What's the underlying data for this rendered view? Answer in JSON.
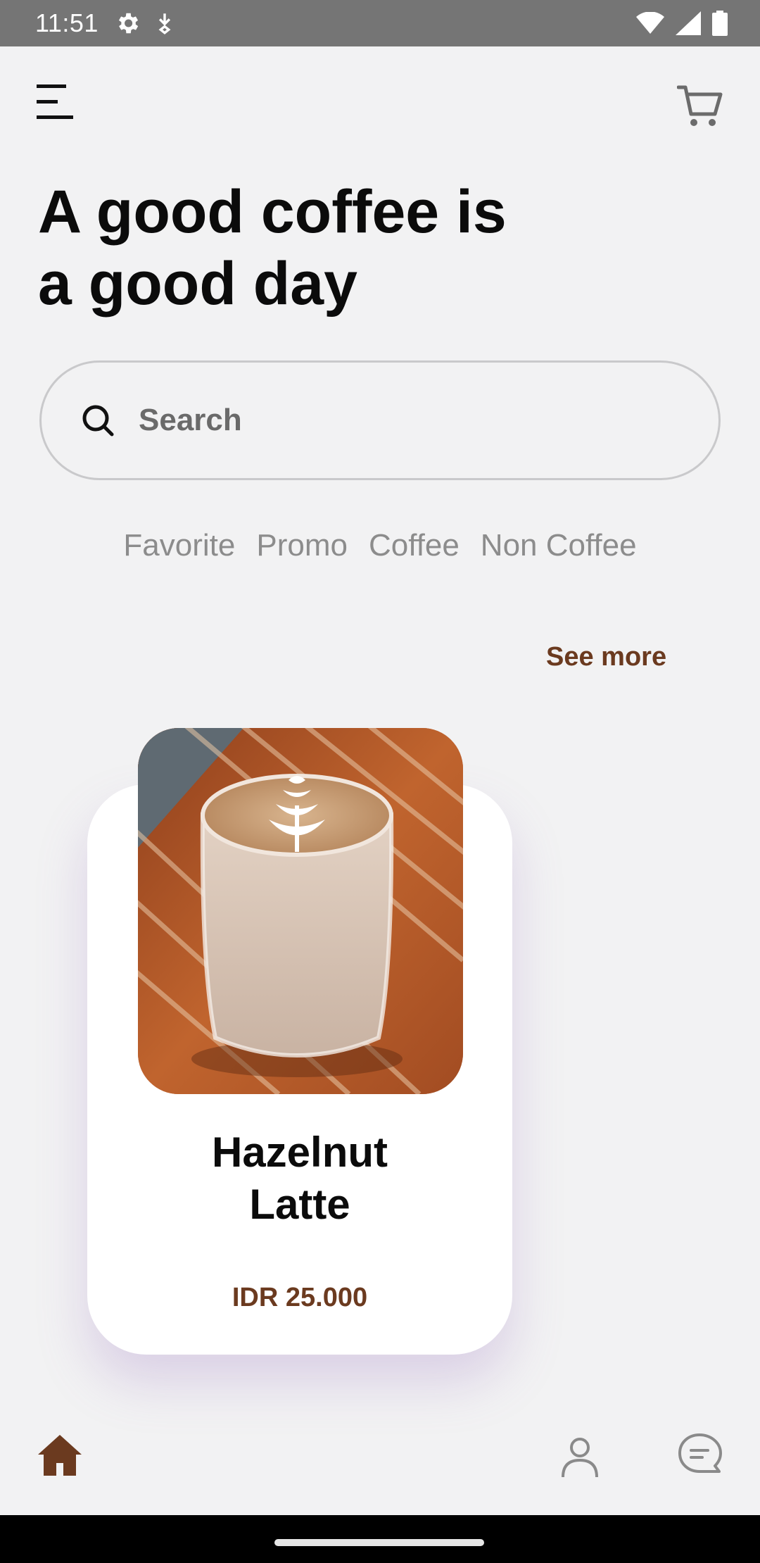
{
  "status_bar": {
    "time": "11:51",
    "left_icons": [
      "settings-icon",
      "download-status-icon"
    ],
    "right_icons": [
      "wifi-icon",
      "signal-icon",
      "battery-icon"
    ]
  },
  "header": {
    "menu_icon": "menu-icon",
    "cart_icon": "cart-icon"
  },
  "headline": {
    "line1": "A good coffee is",
    "line2": "a good day"
  },
  "search": {
    "placeholder": "Search",
    "icon": "search-icon"
  },
  "categories": [
    {
      "label": "Favorite"
    },
    {
      "label": "Promo"
    },
    {
      "label": "Coffee"
    },
    {
      "label": "Non Coffee"
    }
  ],
  "see_more": "See more",
  "product": {
    "name_line1": "Hazelnut",
    "name_line2": "Latte",
    "price": "IDR 25.000",
    "image": "latte-photo"
  },
  "bottom_nav": {
    "items": [
      "home-icon",
      "profile-icon",
      "chat-icon"
    ],
    "active": "home",
    "active_color": "#6b3a1f"
  },
  "colors": {
    "accent": "#6b3a1f",
    "background": "#f2f2f3",
    "card": "#ffffff"
  }
}
